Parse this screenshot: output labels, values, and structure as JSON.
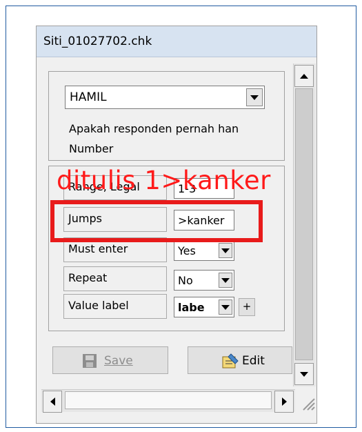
{
  "window": {
    "title": "Siti_01027702.chk"
  },
  "question": {
    "variable": "HAMIL",
    "text": "Apakah responden pernah han",
    "type": "Number"
  },
  "properties": {
    "range_label": "Range, Legal",
    "range_value": "1-3",
    "jumps_label": "Jumps",
    "jumps_value": ">kanker",
    "must_enter_label": "Must enter",
    "must_enter_value": "Yes",
    "repeat_label": "Repeat",
    "repeat_value": "No",
    "value_label_label": "Value label",
    "value_label_value": "labe",
    "add_label": "+"
  },
  "buttons": {
    "save": "Save",
    "edit": "Edit"
  },
  "annotation": {
    "text": "ditulis 1>kanker",
    "color": "#ff1a1a"
  },
  "colors": {
    "titlebar": "#d7e3f1",
    "window_border": "#1e5aa0"
  },
  "icons": [
    "chevron-down-icon",
    "save-disk-icon",
    "edit-pencil-icon",
    "scroll-up-icon",
    "scroll-down-icon",
    "scroll-left-icon",
    "scroll-right-icon",
    "resize-grip-icon"
  ]
}
